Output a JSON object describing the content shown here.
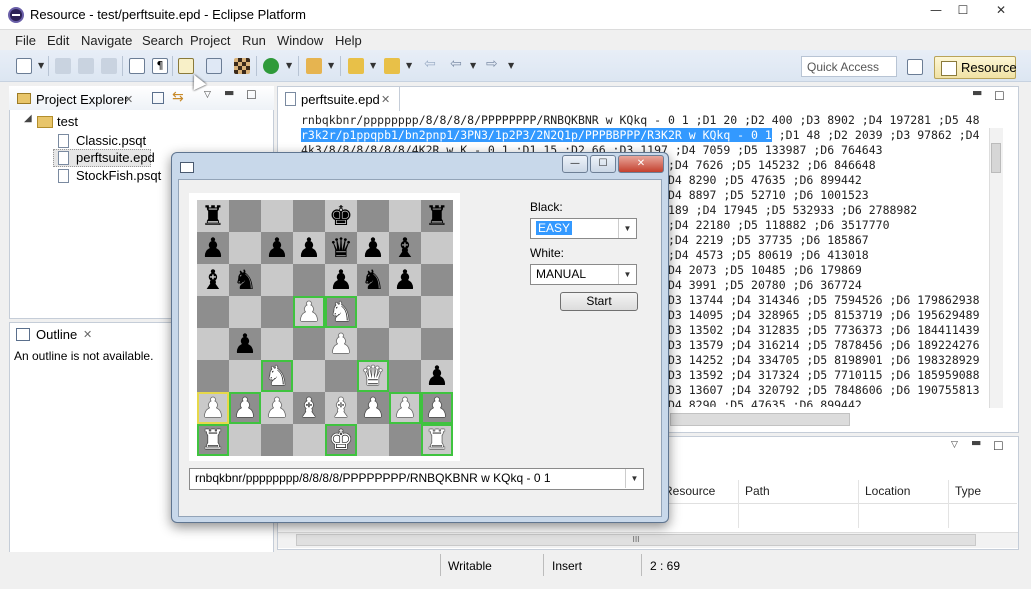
{
  "window": {
    "title": "Resource - test/perftsuite.epd - Eclipse Platform",
    "min": "—",
    "max": "☐",
    "close": "✕"
  },
  "menu": [
    "File",
    "Edit",
    "Navigate",
    "Search",
    "Project",
    "Run",
    "Window",
    "Help"
  ],
  "toolbar": {
    "quick_access_placeholder": "Quick Access",
    "perspective": "Resource"
  },
  "project_explorer": {
    "tab": "Project Explorer",
    "close": "✕",
    "project": "test",
    "files": [
      "Classic.psqt",
      "perftsuite.epd",
      "StockFish.psqt"
    ]
  },
  "outline": {
    "tab": "Outline",
    "close": "✕",
    "message": "An outline is not available."
  },
  "editor": {
    "tab": "perftsuite.epd",
    "close": "✕",
    "lines": [
      "rnbqkbnr/pppppppp/8/8/8/8/PPPPPPPP/RNBQKBNR w KQkq - 0 1 ;D1 20 ;D2 400 ;D3 8902 ;D4 197281 ;D5 48",
      "r3k2r/p1ppqpb1/bn2pnp1/3PN3/1p2P3/2N2Q1p/PPPBBPPP/R3K2R w KQkq - 0 1",
      " ;D1 48 ;D2 2039 ;D3 97862 ;D4",
      "4k3/8/8/8/8/8/8/4K2R w K - 0 1 ;D1 15 ;D2 66 ;D3 1197 ;D4 7059 ;D5 133987 ;D6 764643",
      "                                                     ;D4 7626 ;D5 145232 ;D6 846648",
      "                                                     D4 8290 ;D5 47635 ;D6 899442",
      "                                                     D4 8897 ;D5 52710 ;D6 1001523",
      "                                                     189 ;D4 17945 ;D5 532933 ;D6 2788982",
      "                                                     ;D4 22180 ;D5 118882 ;D6 3517770",
      "                                                     ;D4 2219 ;D5 37735 ;D6 185867",
      "                                                     ;D4 4573 ;D5 80619 ;D6 413018",
      "                                                     D4 2073 ;D5 10485 ;D6 179869",
      "                                                     D4 3991 ;D5 20780 ;D6 367724",
      "                                                     D3 13744 ;D4 314346 ;D5 7594526 ;D6 179862938",
      "                                                     D3 14095 ;D4 328965 ;D5 8153719 ;D6 195629489",
      "                                                     D3 13502 ;D4 312835 ;D5 7736373 ;D6 184411439",
      "                                                     D3 13579 ;D4 316214 ;D5 7878456 ;D6 189224276",
      "                                                     D3 14252 ;D4 334705 ;D5 8198901 ;D6 198328929",
      "                                                     D3 13592 ;D4 317324 ;D5 7710115 ;D6 185959088",
      "                                                     D3 13607 ;D4 320792 ;D5 7848606 ;D6 190755813",
      "                                                     D4 8290 ;D5 47635 ;D6 899442"
    ],
    "hscroll_grip": "III"
  },
  "problems": {
    "columns": [
      "Resource",
      "Path",
      "Location",
      "Type"
    ]
  },
  "dialog": {
    "black_label": "Black:",
    "black_value": "EASY",
    "white_label": "White:",
    "white_value": "MANUAL",
    "start": "Start",
    "fen": "rnbqkbnr/pppppppp/8/8/8/8/PPPPPPPP/RNBQKBNR w KQkq - 0 1",
    "board": [
      [
        "r",
        "",
        "",
        "",
        "k",
        "",
        "",
        "r"
      ],
      [
        "p",
        "",
        "p",
        "p",
        "q",
        "p",
        "b",
        ""
      ],
      [
        "b",
        "n",
        "",
        "",
        "p",
        "n",
        "p",
        ""
      ],
      [
        "",
        "",
        "",
        "P",
        "N",
        "",
        "",
        ""
      ],
      [
        "",
        "p",
        "",
        "",
        "P",
        "",
        "",
        ""
      ],
      [
        "",
        "",
        "N",
        "",
        "",
        "Q",
        "",
        "p"
      ],
      [
        "P",
        "P",
        "P",
        "B",
        "B",
        "P",
        "P",
        "P"
      ],
      [
        "R",
        "",
        "",
        "",
        "K",
        "",
        "",
        "R"
      ]
    ],
    "highlighted": [
      "d5",
      "e5",
      "c3",
      "f3",
      "a2",
      "b2",
      "g2",
      "h2",
      "a1",
      "e1",
      "h1"
    ]
  },
  "status": {
    "writable": "Writable",
    "insert": "Insert",
    "position": "2 : 69"
  }
}
